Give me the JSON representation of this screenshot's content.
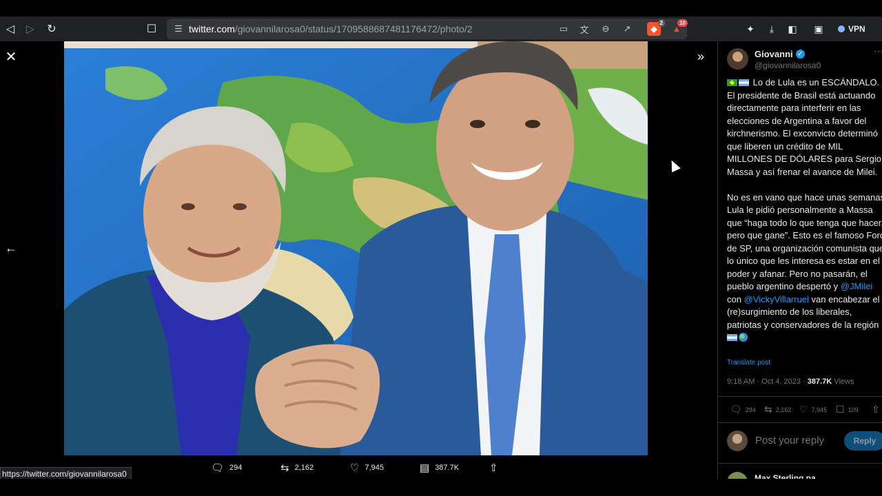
{
  "browser": {
    "url_host": "twitter.com",
    "url_path": "/giovannilarosa0/status/1709588687481176472/photo/2",
    "brave_badge": "2",
    "alert_badge": "10",
    "vpn_label": "VPN",
    "status_url": "https://twitter.com/giovannilarosa0"
  },
  "viewer": {
    "actions": {
      "replies": "294",
      "retweets": "2,162",
      "likes": "7,945",
      "views": "387.7K"
    }
  },
  "tweet": {
    "author_name": "Giovanni",
    "author_handle": "@giovannilarosa0",
    "text_p1": "Lo de Lula es un ESCÁNDALO. El presidente de Brasil está actuando directamente para interferir en las elecciones de Argentina a favor del kirchnerismo. El exconvicto determinó que liberen un crédito de MIL MILLONES DE DÓLARES para Sergio Massa y así frenar el avance de Milei.",
    "text_p2_a": "No es en vano que hace unas semanas Lula le pidió personalmente a Massa que “haga todo lo que tenga que hacer, pero que gane”. Esto es el famoso Foro de SP, una organización comunista que lo único que les interesa es estar en el poder y afanar. Pero no pasarán, el pueblo argentino despertó y ",
    "mention_1": "@JMilei",
    "text_p2_b": " con ",
    "mention_2": "@VickyVillarruel",
    "text_p2_c": " van encabezar el (re)surgimiento de los liberales, patriotas y conservadores de la región ",
    "translate_label": "Translate post",
    "timestamp": "9:18 AM · Oct 4, 2023 · ",
    "views_count": "387.7K",
    "views_label": " Views",
    "stats": {
      "replies": "294",
      "retweets": "2,162",
      "likes": "7,945",
      "bookmarks": "109"
    },
    "reply_placeholder": "Post your reply",
    "reply_button": "Reply",
    "next_reply_user": "Max Sterling pa"
  }
}
